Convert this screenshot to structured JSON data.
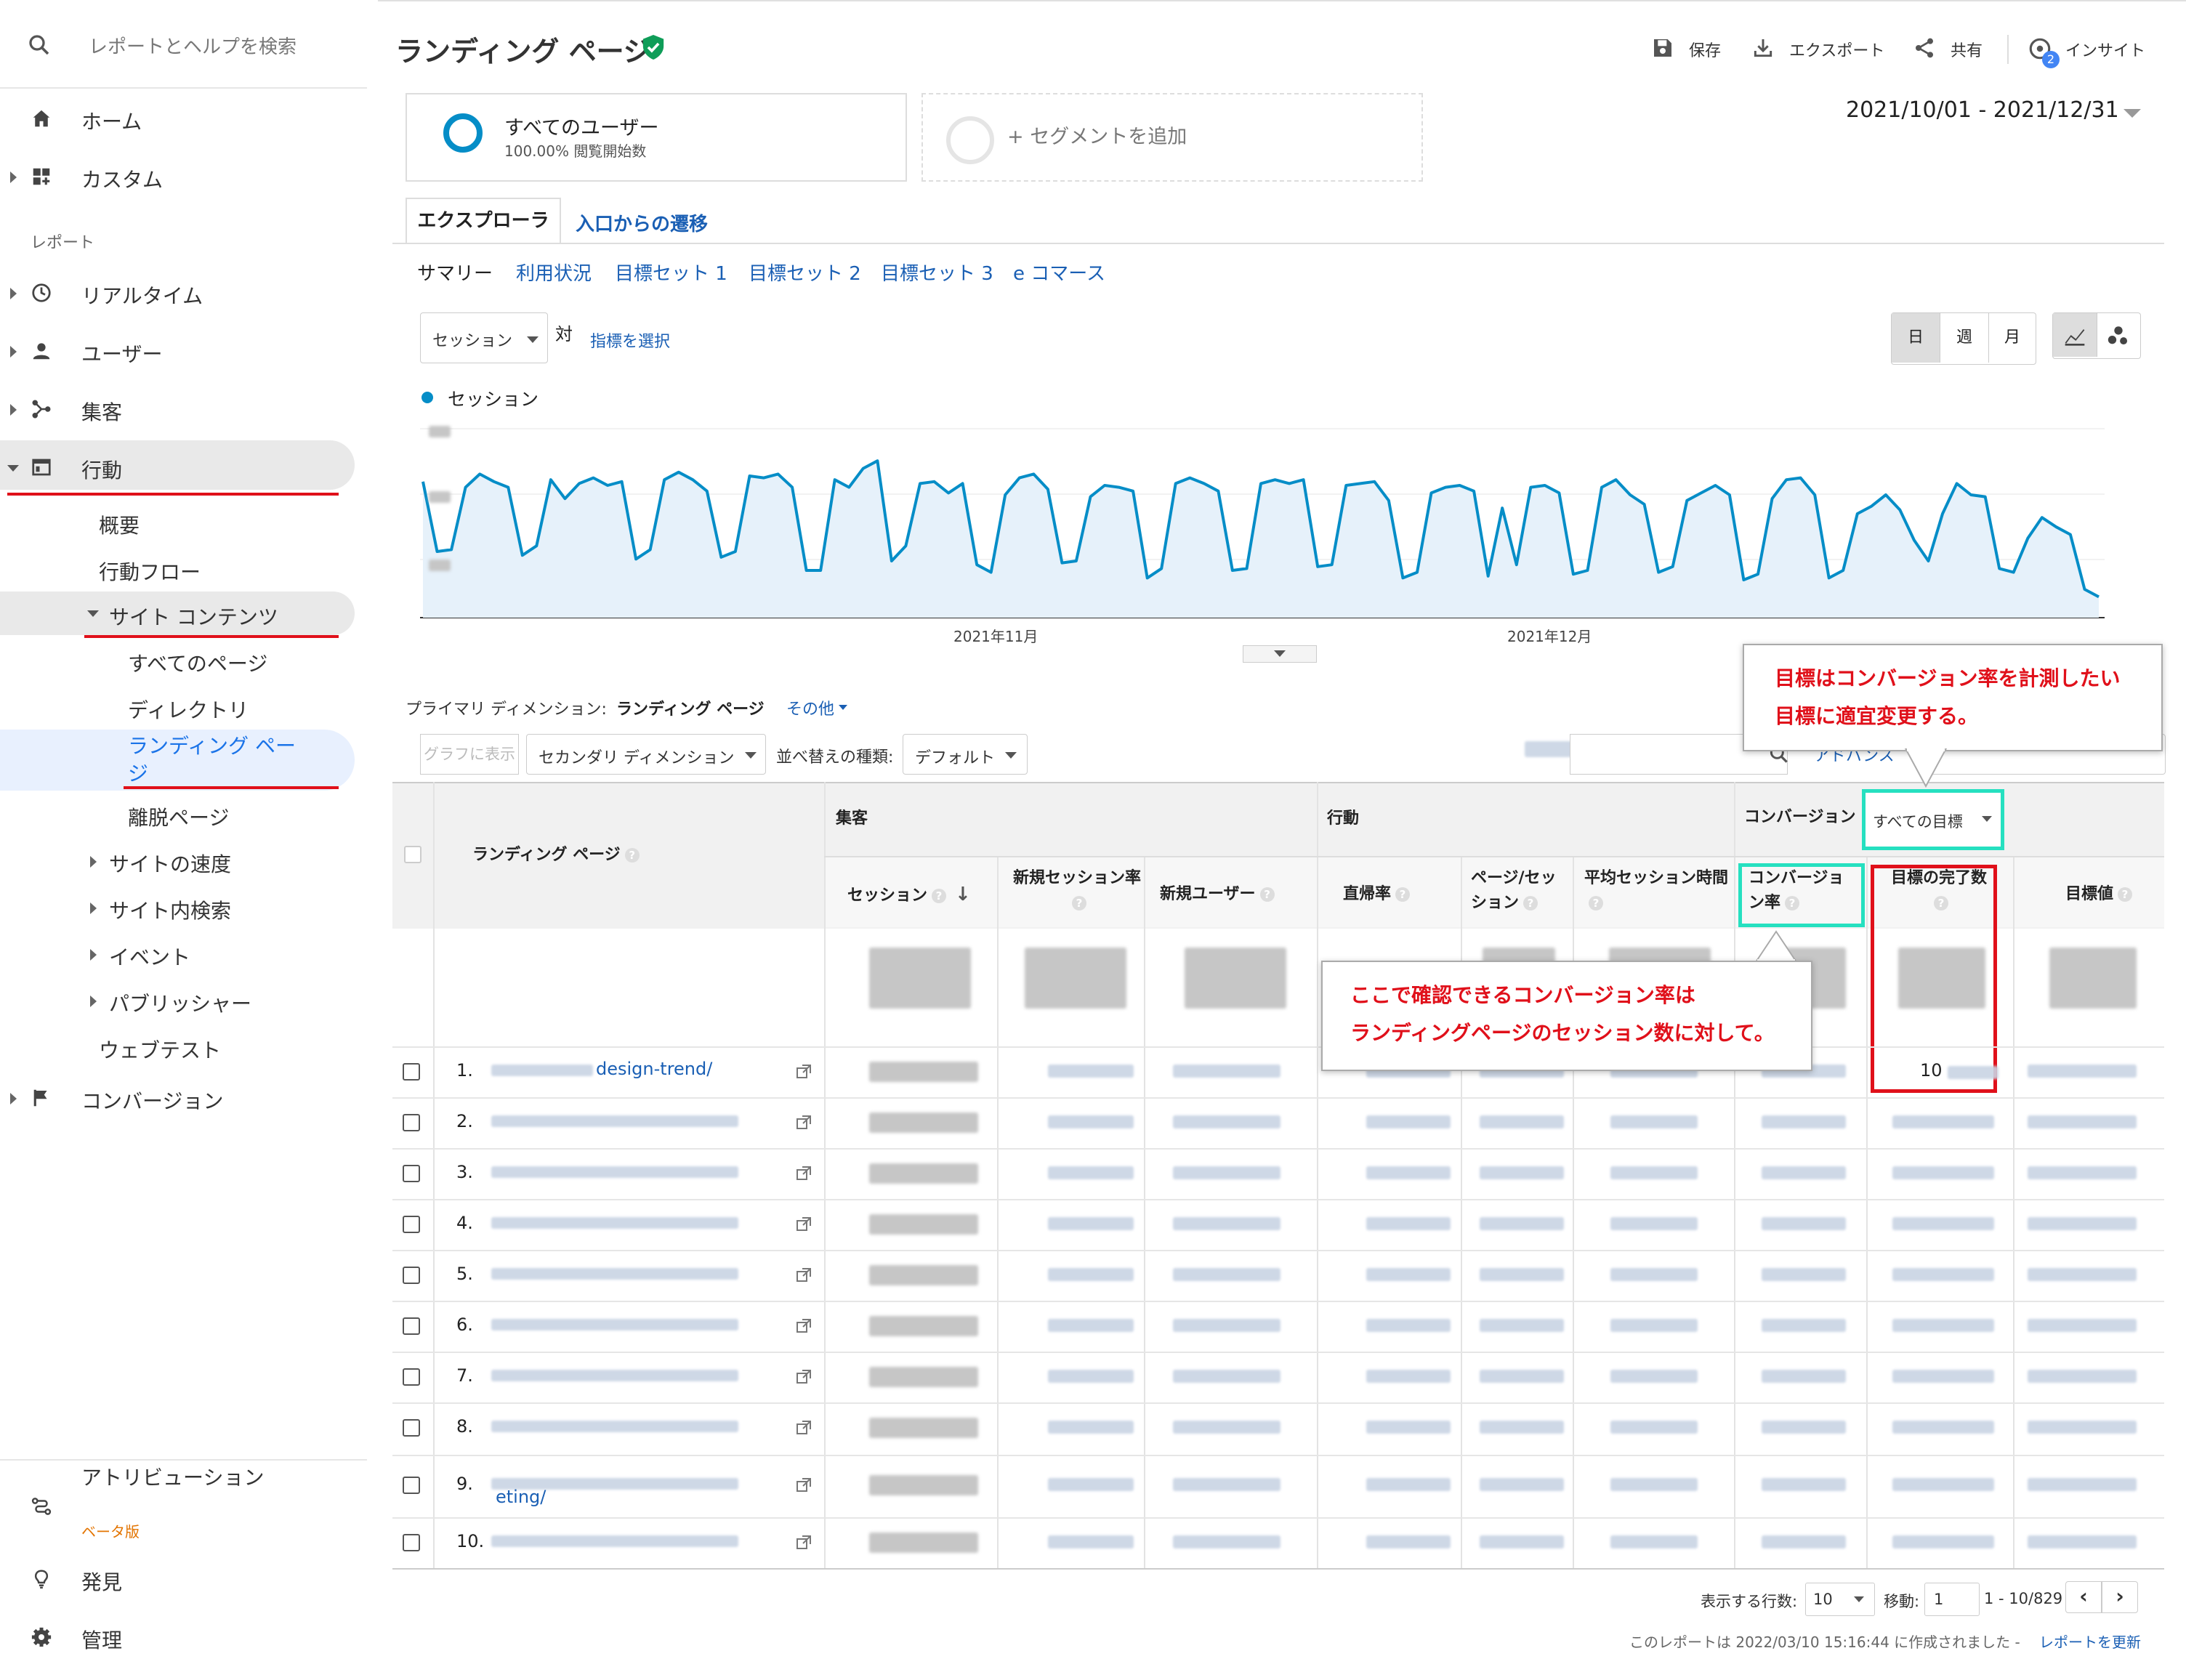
{
  "search": {
    "placeholder": "レポートとヘルプを検索"
  },
  "sidebar": {
    "home": "ホーム",
    "custom": "カスタム",
    "reports_label": "レポート",
    "realtime": "リアルタイム",
    "users": "ユーザー",
    "acquisition": "集客",
    "behavior": "行動",
    "overview": "概要",
    "behavior_flow": "行動フロー",
    "site_content": "サイト コンテンツ",
    "all_pages": "すべてのページ",
    "directory": "ディレクトリ",
    "landing_pages": "ランディング ページ",
    "exit_pages": "離脱ページ",
    "site_speed": "サイトの速度",
    "site_search": "サイト内検索",
    "events": "イベント",
    "publisher": "パブリッシャー",
    "web_test": "ウェブテスト",
    "conversion": "コンバージョン",
    "attribution": "アトリビューション",
    "beta": "ベータ版",
    "discover": "発見",
    "admin": "管理"
  },
  "header": {
    "title": "ランディング ページ",
    "save": "保存",
    "export": "エクスポート",
    "share": "共有",
    "insight": "インサイト",
    "insight_badge": "2",
    "date_range": "2021/10/01 - 2021/12/31"
  },
  "segment": {
    "name": "すべてのユーザー",
    "sub": "100.00% 閲覧開始数",
    "add": "+ セグメントを追加"
  },
  "tabs": {
    "explorer": "エクスプローラ",
    "entrance_paths": "入口からの遷移"
  },
  "subtabs": {
    "summary": "サマリー",
    "usage": "利用状況",
    "goal1": "目標セット 1",
    "goal2": "目標セット 2",
    "goal3": "目標セット 3",
    "ecommerce": "e コマース"
  },
  "chart_controls": {
    "metric": "セッション",
    "vs": "対",
    "select_metric": "指標を選択",
    "day": "日",
    "week": "週",
    "month": "月",
    "legend": "セッション"
  },
  "chart_data": {
    "type": "line",
    "series": [
      {
        "name": "セッション",
        "values": [
          0.72,
          0.35,
          0.36,
          0.69,
          0.76,
          0.72,
          0.69,
          0.33,
          0.38,
          0.73,
          0.63,
          0.71,
          0.74,
          0.7,
          0.72,
          0.31,
          0.36,
          0.73,
          0.77,
          0.73,
          0.67,
          0.32,
          0.35,
          0.75,
          0.74,
          0.76,
          0.69,
          0.25,
          0.25,
          0.73,
          0.69,
          0.79,
          0.83,
          0.3,
          0.38,
          0.71,
          0.72,
          0.66,
          0.71,
          0.28,
          0.24,
          0.65,
          0.74,
          0.76,
          0.68,
          0.29,
          0.3,
          0.64,
          0.7,
          0.69,
          0.67,
          0.21,
          0.26,
          0.71,
          0.74,
          0.71,
          0.67,
          0.25,
          0.26,
          0.71,
          0.73,
          0.71,
          0.73,
          0.27,
          0.28,
          0.7,
          0.71,
          0.72,
          0.62,
          0.21,
          0.24,
          0.66,
          0.69,
          0.7,
          0.67,
          0.22,
          0.58,
          0.28,
          0.69,
          0.7,
          0.66,
          0.23,
          0.25,
          0.69,
          0.73,
          0.65,
          0.6,
          0.24,
          0.27,
          0.62,
          0.66,
          0.7,
          0.65,
          0.2,
          0.23,
          0.63,
          0.73,
          0.74,
          0.65,
          0.21,
          0.25,
          0.55,
          0.59,
          0.65,
          0.57,
          0.41,
          0.3,
          0.55,
          0.71,
          0.65,
          0.64,
          0.26,
          0.24,
          0.42,
          0.53,
          0.48,
          0.44,
          0.15,
          0.11
        ]
      }
    ],
    "x_labels": [
      "2021年11月",
      "2021年12月"
    ]
  },
  "dimension": {
    "primary_label": "プライマリ ディメンション:",
    "primary_value": "ランディング ページ",
    "other": "その他",
    "show_chart": "グラフに表示",
    "secondary": "セカンダリ ディメンション",
    "sort_label": "並べ替えの種類:",
    "sort_value": "デフォルト",
    "advanced": "アドバンス"
  },
  "table": {
    "col_page": "ランディング ページ",
    "group_acq": "集客",
    "group_beh": "行動",
    "group_conv": "コンバージョン",
    "goal_select": "すべての目標",
    "col_sessions": "セッション",
    "col_new_session_rate": "新規セッション率",
    "col_new_users": "新規ユーザー",
    "col_bounce": "直帰率",
    "col_pages_session": "ページ/セッション",
    "col_avg_duration": "平均セッション時間",
    "col_conv_rate": "コンバージョン率",
    "col_goal_completions": "目標の完了数",
    "col_goal_value": "目標値",
    "rows": [
      {
        "num": "1.",
        "page": "design-trend/",
        "goal": "10"
      },
      {
        "num": "2.",
        "page": "",
        "goal": ""
      },
      {
        "num": "3.",
        "page": "",
        "goal": ""
      },
      {
        "num": "4.",
        "page": "",
        "goal": ""
      },
      {
        "num": "5.",
        "page": "",
        "goal": ""
      },
      {
        "num": "6.",
        "page": "",
        "goal": ""
      },
      {
        "num": "7.",
        "page": "",
        "goal": ""
      },
      {
        "num": "8.",
        "page": "",
        "goal": ""
      },
      {
        "num": "9.",
        "page": "eting/",
        "goal": ""
      },
      {
        "num": "10.",
        "page": "",
        "goal": ""
      }
    ]
  },
  "pagination": {
    "rows_label": "表示する行数:",
    "rows_value": "10",
    "goto_label": "移動:",
    "goto_value": "1",
    "range": "1 - 10/829"
  },
  "footer": {
    "created": "このレポートは 2022/03/10 15:16:44 に作成されました -",
    "refresh": "レポートを更新"
  },
  "annotations": {
    "goal_note_1": "目標はコンバージョン率を計測したい",
    "goal_note_2": "目標に適宜変更する。",
    "conv_note_1": "ここで確認できるコンバージョン率は",
    "conv_note_2": "ランディングページのセッション数に対して。"
  },
  "colors": {
    "accent": "#1a5fb4",
    "line": "#058dc7",
    "annotation_red": "#e0101a",
    "annotation_teal": "#26e0c0"
  }
}
